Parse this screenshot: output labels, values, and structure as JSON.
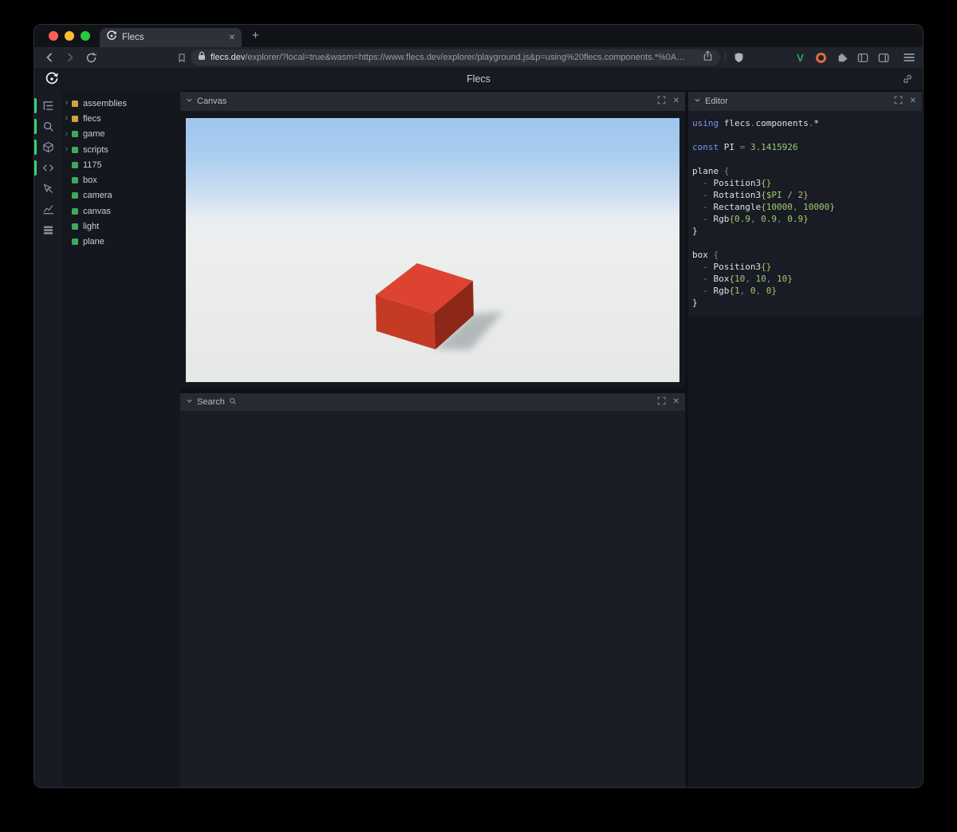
{
  "colors": {
    "yellow": "#cfa53d",
    "green": "#3fa85c",
    "accent": "#38d173",
    "box_red_top": "#dc4431",
    "box_red_left": "#c43a23",
    "box_red_right": "#8f2718"
  },
  "browser": {
    "tab": {
      "title": "Flecs"
    },
    "new_tab_label": "+",
    "address": {
      "domain": "flecs.dev",
      "path": "/explorer/?local=true&wasm=https://www.flecs.dev/explorer/playground.js&p=using%20flecs.components.*%0A…"
    }
  },
  "header": {
    "title": "Flecs"
  },
  "sidebar": {
    "icons": [
      {
        "name": "entities-tree",
        "active": true
      },
      {
        "name": "search",
        "active": true
      },
      {
        "name": "cube",
        "active": true
      },
      {
        "name": "code",
        "active": true
      },
      {
        "name": "inspect",
        "active": false
      },
      {
        "name": "stats-chart",
        "active": false
      },
      {
        "name": "queue-rows",
        "active": false
      }
    ]
  },
  "tree": {
    "items": [
      {
        "label": "assemblies",
        "color": "yellow",
        "expandable": true
      },
      {
        "label": "flecs",
        "color": "yellow",
        "expandable": true
      },
      {
        "label": "game",
        "color": "green",
        "expandable": true
      },
      {
        "label": "scripts",
        "color": "green",
        "expandable": true
      },
      {
        "label": "1175",
        "color": "green",
        "expandable": false
      },
      {
        "label": "box",
        "color": "green",
        "expandable": false
      },
      {
        "label": "camera",
        "color": "green",
        "expandable": false
      },
      {
        "label": "canvas",
        "color": "green",
        "expandable": false
      },
      {
        "label": "light",
        "color": "green",
        "expandable": false
      },
      {
        "label": "plane",
        "color": "green",
        "expandable": false
      }
    ]
  },
  "panels": {
    "canvas": {
      "title": "Canvas"
    },
    "search": {
      "title": "Search"
    },
    "editor": {
      "title": "Editor",
      "code": [
        [
          {
            "c": "kw",
            "t": "using "
          },
          {
            "c": "id",
            "t": "flecs"
          },
          {
            "c": "punc",
            "t": "."
          },
          {
            "c": "id",
            "t": "components"
          },
          {
            "c": "punc",
            "t": "."
          },
          {
            "c": "id",
            "t": "*"
          }
        ],
        [],
        [
          {
            "c": "kw",
            "t": "const "
          },
          {
            "c": "id",
            "t": "PI "
          },
          {
            "c": "punc",
            "t": "= "
          },
          {
            "c": "num",
            "t": "3.1415926"
          }
        ],
        [],
        [
          {
            "c": "id",
            "t": "plane "
          },
          {
            "c": "punc",
            "t": "{"
          }
        ],
        [
          {
            "c": "punc",
            "t": "  - "
          },
          {
            "c": "id",
            "t": "Position3"
          },
          {
            "c": "brace",
            "t": "{}"
          }
        ],
        [
          {
            "c": "punc",
            "t": "  - "
          },
          {
            "c": "id",
            "t": "Rotation3"
          },
          {
            "c": "brace",
            "t": "{"
          },
          {
            "c": "num",
            "t": "$PI / 2"
          },
          {
            "c": "brace",
            "t": "}"
          }
        ],
        [
          {
            "c": "punc",
            "t": "  - "
          },
          {
            "c": "id",
            "t": "Rectangle"
          },
          {
            "c": "brace",
            "t": "{"
          },
          {
            "c": "num",
            "t": "10000"
          },
          {
            "c": "punc",
            "t": ", "
          },
          {
            "c": "num",
            "t": "10000"
          },
          {
            "c": "brace",
            "t": "}"
          }
        ],
        [
          {
            "c": "punc",
            "t": "  - "
          },
          {
            "c": "id",
            "t": "Rgb"
          },
          {
            "c": "brace",
            "t": "{"
          },
          {
            "c": "num",
            "t": "0.9"
          },
          {
            "c": "punc",
            "t": ", "
          },
          {
            "c": "num",
            "t": "0.9"
          },
          {
            "c": "punc",
            "t": ", "
          },
          {
            "c": "num",
            "t": "0.9"
          },
          {
            "c": "brace",
            "t": "}"
          }
        ],
        [
          {
            "c": "id",
            "t": "}"
          }
        ],
        [],
        [
          {
            "c": "id",
            "t": "box "
          },
          {
            "c": "punc",
            "t": "{"
          }
        ],
        [
          {
            "c": "punc",
            "t": "  - "
          },
          {
            "c": "id",
            "t": "Position3"
          },
          {
            "c": "brace",
            "t": "{}"
          }
        ],
        [
          {
            "c": "punc",
            "t": "  - "
          },
          {
            "c": "id",
            "t": "Box"
          },
          {
            "c": "brace",
            "t": "{"
          },
          {
            "c": "num",
            "t": "10"
          },
          {
            "c": "punc",
            "t": ", "
          },
          {
            "c": "num",
            "t": "10"
          },
          {
            "c": "punc",
            "t": ", "
          },
          {
            "c": "num",
            "t": "10"
          },
          {
            "c": "brace",
            "t": "}"
          }
        ],
        [
          {
            "c": "punc",
            "t": "  - "
          },
          {
            "c": "id",
            "t": "Rgb"
          },
          {
            "c": "brace",
            "t": "{"
          },
          {
            "c": "num",
            "t": "1"
          },
          {
            "c": "punc",
            "t": ", "
          },
          {
            "c": "num",
            "t": "0"
          },
          {
            "c": "punc",
            "t": ", "
          },
          {
            "c": "num",
            "t": "0"
          },
          {
            "c": "brace",
            "t": "}"
          }
        ],
        [
          {
            "c": "id",
            "t": "}"
          }
        ]
      ]
    }
  }
}
